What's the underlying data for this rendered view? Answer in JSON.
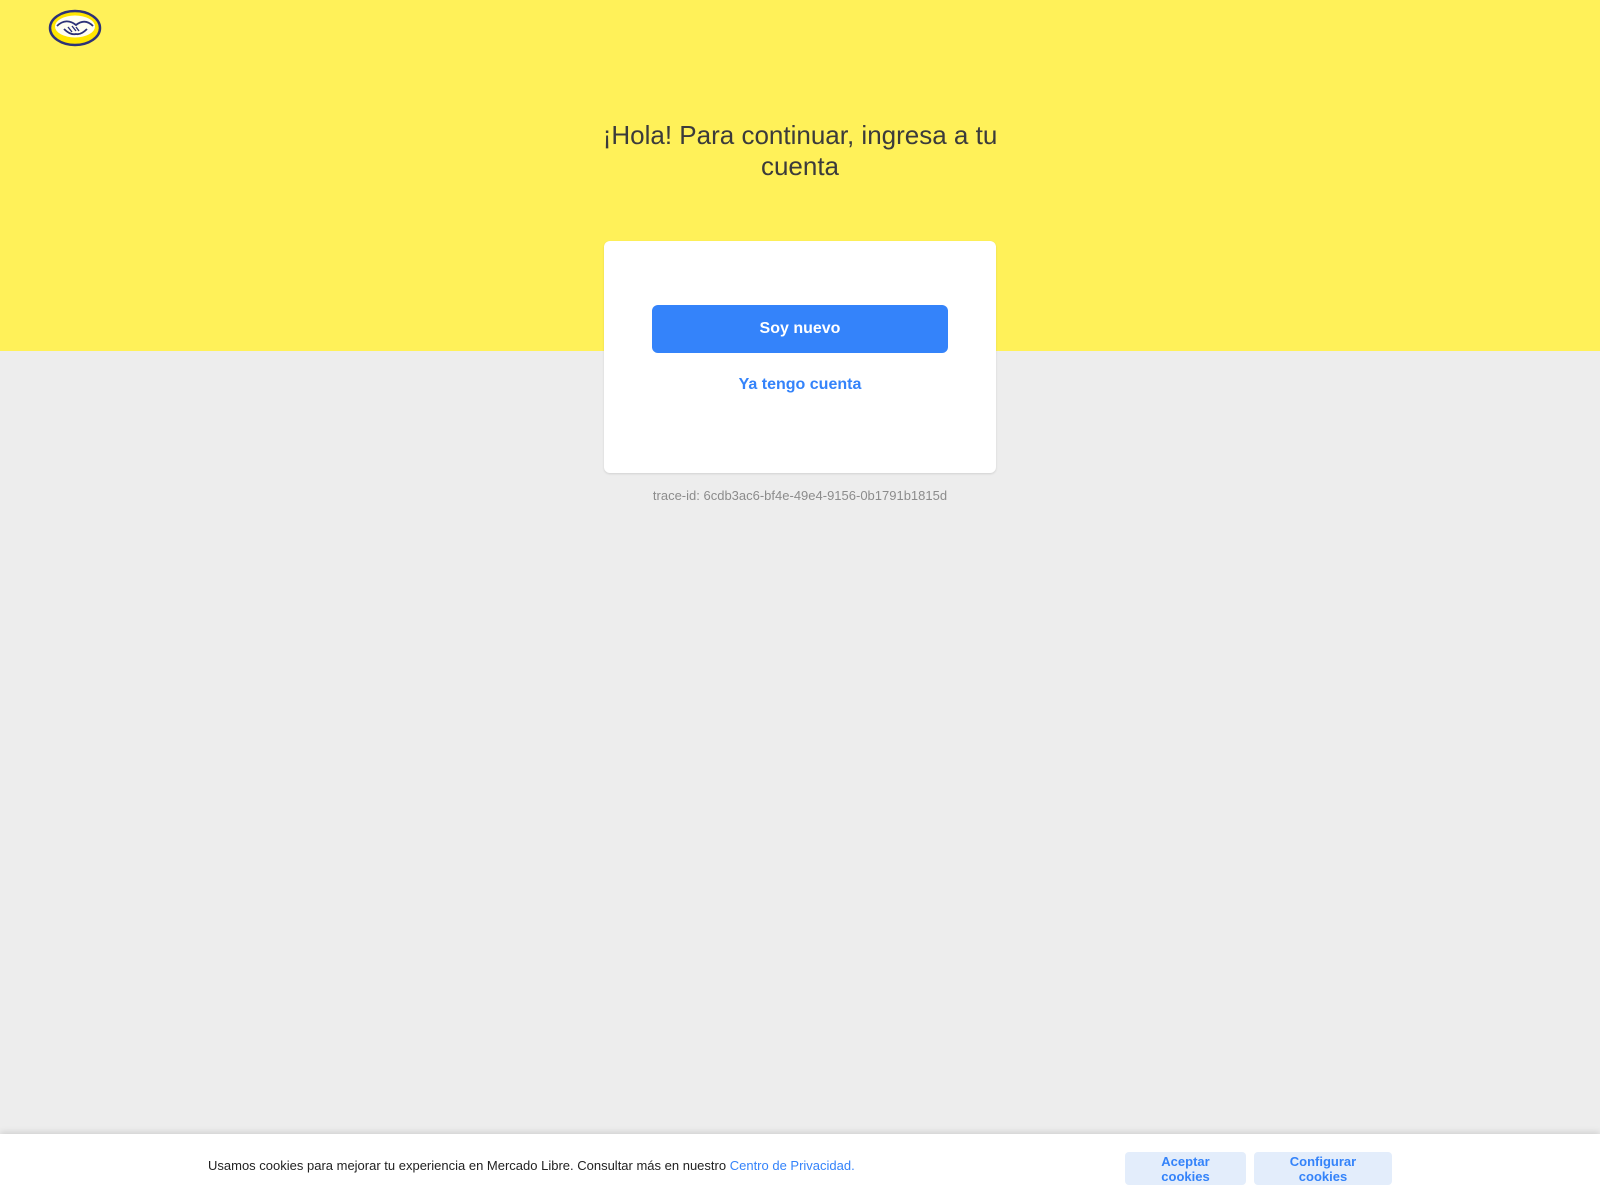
{
  "header": {
    "logo_icon": "mercado-libre-handshake-logo",
    "title": "¡Hola! Para continuar, ingresa a tu cuenta"
  },
  "card": {
    "primary_button": "Soy nuevo",
    "secondary_link": "Ya tengo cuenta"
  },
  "trace_id": "trace-id: 6cdb3ac6-bf4e-49e4-9156-0b1791b1815d",
  "cookie_bar": {
    "message": "Usamos cookies para mejorar tu experiencia en Mercado Libre. Consultar más en nuestro",
    "privacy_link": "Centro de Privacidad.",
    "accept_button": "Aceptar cookies",
    "configure_button": "Configurar cookies"
  },
  "colors": {
    "header_yellow": "#fff159",
    "background_gray": "#ededed",
    "primary_blue": "#3483fa",
    "secondary_button_bg": "#e3edfb"
  }
}
